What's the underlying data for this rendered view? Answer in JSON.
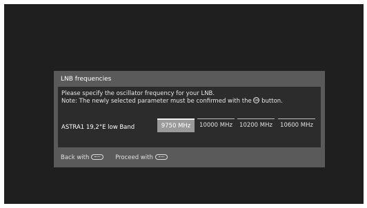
{
  "dialog": {
    "title": "LNB frequencies",
    "instruction_line1": "Please specify the oscillator frequency for your LNB.",
    "instruction_line2_pre": "Note: The newly selected parameter must be confirmed with the",
    "instruction_line2_post": "button.",
    "ok_icon_label": "OK",
    "lnb_label": "ASTRA1 19,2°E low Band",
    "options": [
      "9750 MHz",
      "10000 MHz",
      "10200 MHz",
      "10600 MHz"
    ],
    "selected_option": "9750 MHz"
  },
  "footer": {
    "back_label": "Back with",
    "proceed_label": "Proceed with"
  },
  "icons": {
    "ok": "ok-button-icon",
    "back": "back-key-icon",
    "proceed": "forward-key-icon"
  }
}
